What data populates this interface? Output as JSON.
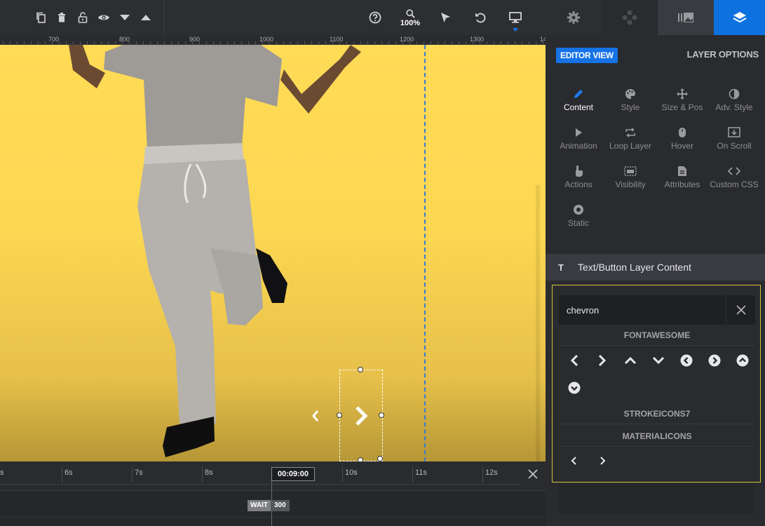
{
  "toolbar": {
    "left_buttons": [
      "duplicate-icon",
      "trash-icon",
      "unlock-icon",
      "eye-icon",
      "caret-down-icon",
      "caret-up-icon"
    ],
    "zoom_label": "100%",
    "right_buttons": [
      "help-icon",
      "zoom-icon",
      "pointer-icon",
      "undo-icon",
      "desktop-icon"
    ]
  },
  "ruler": {
    "labels": [
      "700",
      "800",
      "900",
      "1000",
      "1100",
      "1200",
      "1300",
      "14"
    ]
  },
  "timeline": {
    "labels": [
      "s",
      "6s",
      "7s",
      "8s",
      "10s",
      "11s",
      "12s"
    ],
    "current_time": "00:09:00",
    "wait_label": "WAIT",
    "wait_value": "300"
  },
  "panel_tabs": [
    "settings-icon",
    "move-icon",
    "media-icon",
    "layers-icon"
  ],
  "panel": {
    "editor_view": "EDITOR VIEW",
    "layer_options": "LAYER OPTIONS",
    "options": [
      {
        "label": "Content",
        "icon": "pencil-icon",
        "active": true
      },
      {
        "label": "Style",
        "icon": "palette-icon"
      },
      {
        "label": "Size & Pos",
        "icon": "arrows-icon"
      },
      {
        "label": "Adv. Style",
        "icon": "contrast-icon"
      },
      {
        "label": "Animation",
        "icon": "play-icon"
      },
      {
        "label": "Loop Layer",
        "icon": "loop-icon"
      },
      {
        "label": "Hover",
        "icon": "mouse-icon"
      },
      {
        "label": "On Scroll",
        "icon": "scroll-icon"
      },
      {
        "label": "Actions",
        "icon": "hand-pointer-icon"
      },
      {
        "label": "Visibility",
        "icon": "visibility-icon"
      },
      {
        "label": "Attributes",
        "icon": "file-icon"
      },
      {
        "label": "Custom CSS",
        "icon": "code-icon"
      },
      {
        "label": "Static",
        "icon": "target-icon"
      }
    ],
    "section_title": "Text/Button Layer Content",
    "section_icon": "T"
  },
  "icon_picker": {
    "search_value": "chevron",
    "libraries": [
      {
        "name": "FONTAWESOME",
        "icons": [
          "chevron-left-icon",
          "chevron-right-icon",
          "chevron-up-icon",
          "chevron-down-icon",
          "chevron-circle-left-icon",
          "chevron-circle-right-icon",
          "chevron-circle-up-icon",
          "chevron-circle-down-icon"
        ]
      },
      {
        "name": "STROKEICONS7",
        "icons": []
      },
      {
        "name": "MATERIALICONS",
        "icons": [
          "chevron-left-icon",
          "chevron-right-icon"
        ]
      }
    ]
  },
  "colors": {
    "accent": "#1673e6",
    "canvas_bg": "#ffdb56",
    "picker_border": "#d3c43b"
  }
}
